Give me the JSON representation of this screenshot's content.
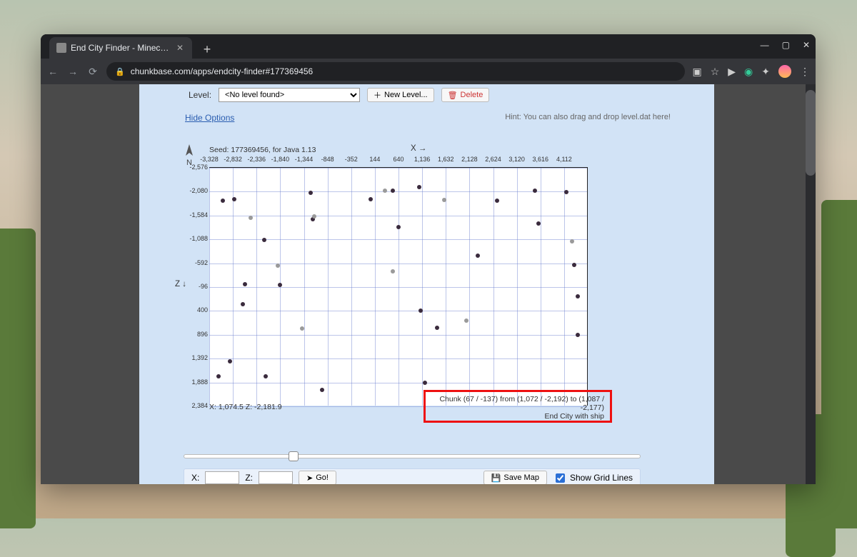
{
  "browser": {
    "tab_title": "End City Finder - Minecraft App",
    "url": "chunkbase.com/apps/endcity-finder#177369456"
  },
  "level_bar": {
    "label": "Level:",
    "selected": "<No level found>",
    "new_level": "New Level...",
    "delete": "Delete"
  },
  "options": {
    "hide_options": "Hide Options",
    "hint": "Hint: You can also drag and drop level.dat here!"
  },
  "chart_data": {
    "type": "scatter",
    "seed_caption": "Seed: 177369456, for Java 1.13",
    "x_axis_label": "X →",
    "z_axis_label": "Z\n↓",
    "compass_label": "N",
    "x_ticks": [
      -3328,
      -2832,
      -2336,
      -1840,
      -1344,
      -848,
      -352,
      144,
      640,
      1136,
      1632,
      2128,
      2624,
      3120,
      3616,
      4112
    ],
    "y_ticks": [
      -2576,
      -2080,
      -1584,
      -1088,
      -592,
      -96,
      400,
      896,
      1392,
      1888,
      2384
    ],
    "xlim": [
      -3328,
      4608
    ],
    "ylim": [
      -2576,
      2384
    ],
    "series": [
      {
        "name": "End City with ship",
        "color": "#3a2b3d",
        "points": [
          [
            -3050,
            -1900
          ],
          [
            -2800,
            -1920
          ],
          [
            -3140,
            1760
          ],
          [
            -2900,
            1450
          ],
          [
            -2580,
            -160
          ],
          [
            -2180,
            -1080
          ],
          [
            -2620,
            260
          ],
          [
            -1850,
            -140
          ],
          [
            -2150,
            1760
          ],
          [
            -1200,
            -2050
          ],
          [
            -1150,
            -1500
          ],
          [
            -960,
            2040
          ],
          [
            56,
            -1930
          ],
          [
            520,
            -2100
          ],
          [
            640,
            -1350
          ],
          [
            1080,
            -2180
          ],
          [
            1110,
            400
          ],
          [
            1450,
            750
          ],
          [
            1200,
            1900
          ],
          [
            2300,
            -750
          ],
          [
            2700,
            -1900
          ],
          [
            3500,
            -2100
          ],
          [
            3580,
            -1420
          ],
          [
            4160,
            -2070
          ],
          [
            4330,
            -550
          ],
          [
            4400,
            900
          ],
          [
            4400,
            100
          ]
        ]
      },
      {
        "name": "End City",
        "color": "#9a9a9a",
        "points": [
          [
            -2460,
            -1530
          ],
          [
            -1890,
            -540
          ],
          [
            -1380,
            760
          ],
          [
            -1120,
            -1560
          ],
          [
            360,
            -2100
          ],
          [
            520,
            -420
          ],
          [
            1600,
            -1910
          ],
          [
            2060,
            600
          ],
          [
            4280,
            -1050
          ]
        ]
      }
    ],
    "cursor_readout": "X: 1,074.5   Z: -2,181.9",
    "hover_info_line1": "Chunk (67 / -137) from (1,072 / -2,192) to (1,087 / -2,177)",
    "hover_info_line2": "End City with ship"
  },
  "footer": {
    "x_label": "X:",
    "z_label": "Z:",
    "go": "Go!",
    "save_map": "Save Map",
    "show_grid": "Show Grid Lines",
    "show_grid_checked": true,
    "zoom_pct": 24
  }
}
